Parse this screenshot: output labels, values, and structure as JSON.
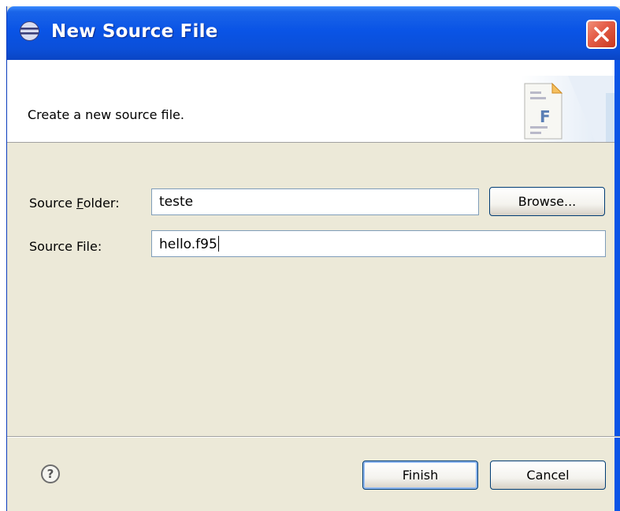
{
  "window": {
    "title": "New Source File",
    "icon": "eclipse-icon"
  },
  "header": {
    "message": "Create a new source file.",
    "image_letter": "F"
  },
  "form": {
    "source_folder": {
      "label": "Source Folder:",
      "mnemonic": "F",
      "value": "teste"
    },
    "source_file": {
      "label": "Source File:",
      "value": "hello.f95"
    },
    "browse_label": "Browse..."
  },
  "footer": {
    "finish_label": "Finish",
    "cancel_label": "Cancel"
  },
  "colors": {
    "titlebar": "#0a54e6",
    "dialog_bg": "#ece9d8",
    "close_button": "#e5604a"
  }
}
